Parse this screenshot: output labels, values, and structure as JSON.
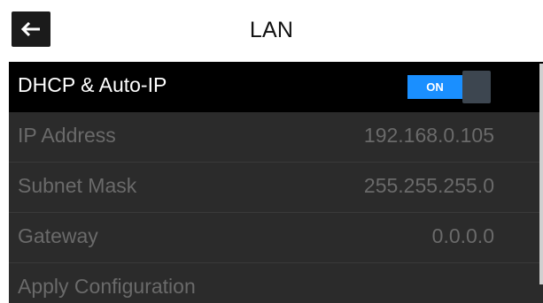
{
  "header": {
    "title": "LAN",
    "back_icon": "arrow-left-icon"
  },
  "settings": {
    "dhcp": {
      "label": "DHCP & Auto-IP",
      "toggle_state": "ON",
      "enabled": true
    },
    "ip_address": {
      "label": "IP Address",
      "value": "192.168.0.105"
    },
    "subnet_mask": {
      "label": "Subnet Mask",
      "value": "255.255.255.0"
    },
    "gateway": {
      "label": "Gateway",
      "value": "0.0.0.0"
    },
    "apply": {
      "label": "Apply Configuration"
    }
  },
  "colors": {
    "toggle_on": "#1a8fff",
    "active_row": "#000000",
    "inactive_row": "#2b2b2b",
    "disabled_text": "#6a6a6a"
  }
}
